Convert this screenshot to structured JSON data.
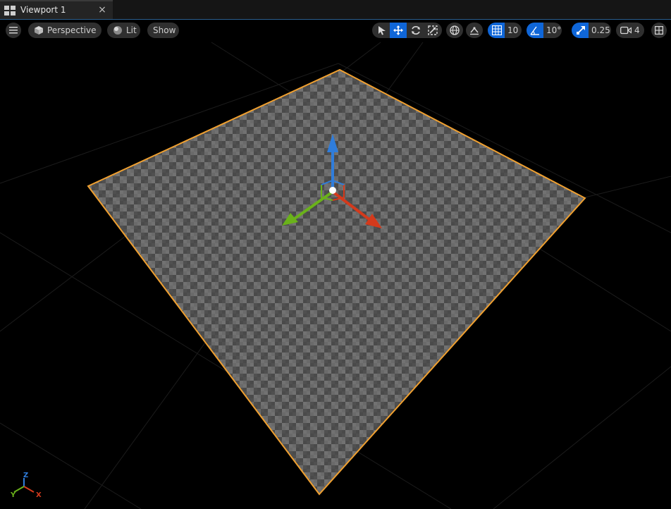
{
  "tab": {
    "title": "Viewport 1",
    "close": "×"
  },
  "toolbar": {
    "view_mode": "Perspective",
    "lighting": "Lit",
    "show": "Show",
    "grid_snap_value": "10",
    "rotation_snap_value": "10°",
    "scale_snap_value": "0.25",
    "camera_speed_value": "4"
  },
  "axis_indicator": {
    "z": "Z",
    "y": "Y",
    "x": "X"
  },
  "colors": {
    "selection_outline": "#f0a030",
    "gizmo_x": "#d43a1c",
    "gizmo_y": "#6ab21a",
    "gizmo_z": "#2f7ddc",
    "accent": "#0f66d8"
  }
}
